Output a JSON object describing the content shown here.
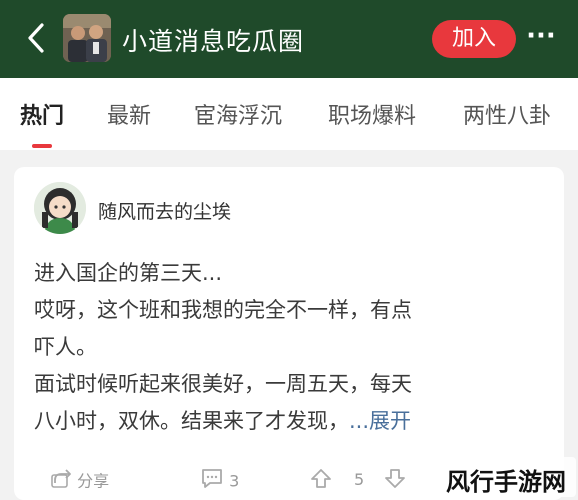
{
  "header": {
    "group_title": "小道消息吃瓜圈",
    "join_label": "加入",
    "more_label": "···",
    "bg_color": "#1f4a2a"
  },
  "tabs": [
    {
      "label": "热门",
      "active": true
    },
    {
      "label": "最新",
      "active": false
    },
    {
      "label": "宦海浮沉",
      "active": false
    },
    {
      "label": "职场爆料",
      "active": false
    },
    {
      "label": "两性八卦",
      "active": false
    }
  ],
  "post": {
    "author": "随风而去的尘埃",
    "lines": [
      "进入国企的第三天...",
      "哎呀，这个班和我想的完全不一样，有点",
      "吓人。",
      "面试时候听起来很美好，一周五天，每天",
      "八小时，双休。结果来了才发现，"
    ],
    "expand_label": "...展开",
    "share_label": "分享",
    "comment_count": "3",
    "vote_count": "5"
  },
  "watermark": {
    "text": "风行手游网"
  },
  "colors": {
    "accent": "#e8383d",
    "link": "#496f9b"
  }
}
